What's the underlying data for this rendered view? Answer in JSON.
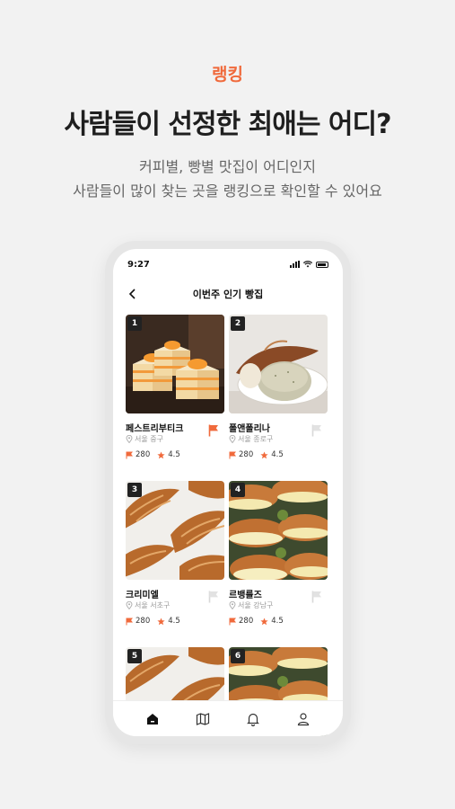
{
  "header": {
    "tag": "랭킹",
    "headline": "사람들이 선정한 최애는 어디?",
    "sub_line1": "커피별, 빵별 맛집이 어디인지",
    "sub_line2": "사람들이 많이 찾는 곳을 랭킹으로 확인할 수 있어요"
  },
  "phone": {
    "status_time": "9:27",
    "nav_title": "이번주 인기 빵집",
    "items": [
      {
        "rank": "1",
        "name": "페스트리부티크",
        "location": "서울 중구",
        "flags": "280",
        "rating": "4.5",
        "bookmarked": true,
        "image": "layer-cake"
      },
      {
        "rank": "2",
        "name": "폴앤폴리나",
        "location": "서울 종로구",
        "flags": "280",
        "rating": "4.5",
        "bookmarked": false,
        "image": "bread-plate"
      },
      {
        "rank": "3",
        "name": "크리미엘",
        "location": "서울 서초구",
        "flags": "280",
        "rating": "4.5",
        "bookmarked": false,
        "image": "croissant"
      },
      {
        "rank": "4",
        "name": "르뱅룰즈",
        "location": "서울 강남구",
        "flags": "280",
        "rating": "4.5",
        "bookmarked": false,
        "image": "egg-roll"
      },
      {
        "rank": "5",
        "image": "croissant"
      },
      {
        "rank": "6",
        "image": "egg-roll"
      }
    ],
    "tabs": [
      "home-icon",
      "map-icon",
      "bell-icon",
      "profile-icon"
    ]
  },
  "colors": {
    "accent": "#f06a3c",
    "background": "#f2f2f2",
    "star": "#f06a3c"
  }
}
